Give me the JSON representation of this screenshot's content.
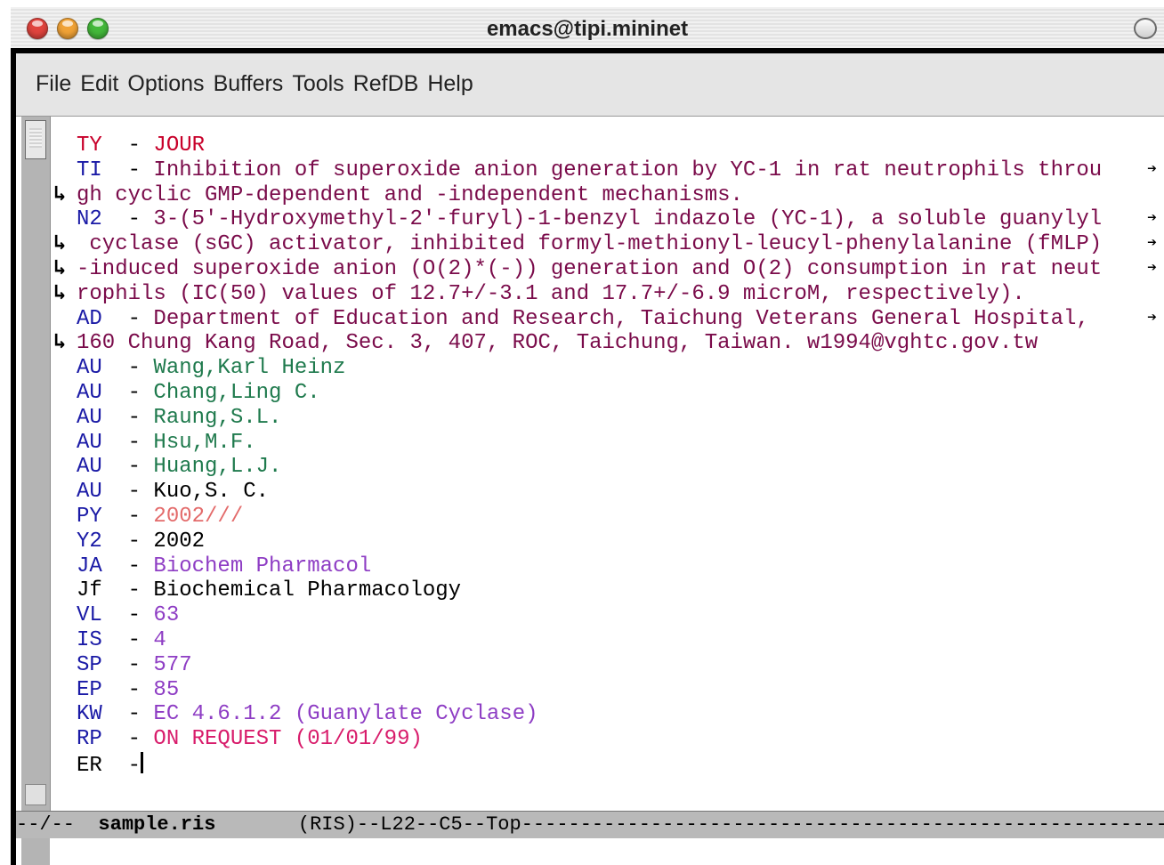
{
  "window": {
    "title": "emacs@tipi.mininet"
  },
  "menu": [
    "File",
    "Edit",
    "Options",
    "Buffers",
    "Tools",
    "RefDB",
    "Help"
  ],
  "lines": [
    {
      "wrap": "",
      "tag": "TY",
      "sep": "  - ",
      "value": "JOUR",
      "tag_color": "red",
      "value_color": "red",
      "end": ""
    },
    {
      "wrap": "",
      "tag": "TI",
      "sep": "  - ",
      "value": "Inhibition of superoxide anion generation by YC-1 in rat neutrophils throu",
      "tag_color": "blue",
      "value_color": "maroon",
      "end": "➔"
    },
    {
      "wrap": "↳",
      "tag": "",
      "sep": "",
      "value": "gh cyclic GMP-dependent and -independent mechanisms.",
      "tag_color": "blue",
      "value_color": "maroon",
      "end": ""
    },
    {
      "wrap": "",
      "tag": "N2",
      "sep": "  - ",
      "value": "3-(5'-Hydroxymethyl-2'-furyl)-1-benzyl indazole (YC-1), a soluble guanylyl",
      "tag_color": "blue",
      "value_color": "maroon",
      "end": "➔"
    },
    {
      "wrap": "↳",
      "tag": "",
      "sep": "",
      "value": " cyclase (sGC) activator, inhibited formyl-methionyl-leucyl-phenylalanine (fMLP)",
      "tag_color": "blue",
      "value_color": "maroon",
      "end": "➔"
    },
    {
      "wrap": "↳",
      "tag": "",
      "sep": "",
      "value": "-induced superoxide anion (O(2)*(-)) generation and O(2) consumption in rat neut",
      "tag_color": "blue",
      "value_color": "maroon",
      "end": "➔"
    },
    {
      "wrap": "↳",
      "tag": "",
      "sep": "",
      "value": "rophils (IC(50) values of 12.7+/-3.1 and 17.7+/-6.9 microM, respectively).",
      "tag_color": "blue",
      "value_color": "maroon",
      "end": ""
    },
    {
      "wrap": "",
      "tag": "AD",
      "sep": "  - ",
      "value": "Department of Education and Research, Taichung Veterans General Hospital, ",
      "tag_color": "blue",
      "value_color": "maroon",
      "end": "➔"
    },
    {
      "wrap": "↳",
      "tag": "",
      "sep": "",
      "value": "160 Chung Kang Road, Sec. 3, 407, ROC, Taichung, Taiwan. w1994@vghtc.gov.tw",
      "tag_color": "blue",
      "value_color": "maroon",
      "end": ""
    },
    {
      "wrap": "",
      "tag": "AU",
      "sep": "  - ",
      "value": "Wang,Karl Heinz",
      "tag_color": "blue",
      "value_color": "green",
      "end": ""
    },
    {
      "wrap": "",
      "tag": "AU",
      "sep": "  - ",
      "value": "Chang,Ling C.",
      "tag_color": "blue",
      "value_color": "green",
      "end": ""
    },
    {
      "wrap": "",
      "tag": "AU",
      "sep": "  - ",
      "value": "Raung,S.L.",
      "tag_color": "blue",
      "value_color": "green",
      "end": ""
    },
    {
      "wrap": "",
      "tag": "AU",
      "sep": "  - ",
      "value": "Hsu,M.F.",
      "tag_color": "blue",
      "value_color": "green",
      "end": ""
    },
    {
      "wrap": "",
      "tag": "AU",
      "sep": "  - ",
      "value": "Huang,L.J.",
      "tag_color": "blue",
      "value_color": "green",
      "end": ""
    },
    {
      "wrap": "",
      "tag": "AU",
      "sep": "  - ",
      "value": "Kuo,S. C.",
      "tag_color": "blue",
      "value_color": "black",
      "end": ""
    },
    {
      "wrap": "",
      "tag": "PY",
      "sep": "  - ",
      "value": "2002///",
      "tag_color": "blue",
      "value_color": "salmon",
      "end": ""
    },
    {
      "wrap": "",
      "tag": "Y2",
      "sep": "  - ",
      "value": "2002",
      "tag_color": "blue",
      "value_color": "black",
      "end": ""
    },
    {
      "wrap": "",
      "tag": "JA",
      "sep": "  - ",
      "value": "Biochem Pharmacol",
      "tag_color": "blue",
      "value_color": "purple",
      "end": ""
    },
    {
      "wrap": "",
      "tag": "Jf",
      "sep": "  - ",
      "value": "Biochemical Pharmacology",
      "tag_color": "black",
      "value_color": "black",
      "end": ""
    },
    {
      "wrap": "",
      "tag": "VL",
      "sep": "  - ",
      "value": "63",
      "tag_color": "blue",
      "value_color": "purple",
      "end": ""
    },
    {
      "wrap": "",
      "tag": "IS",
      "sep": "  - ",
      "value": "4",
      "tag_color": "blue",
      "value_color": "purple",
      "end": ""
    },
    {
      "wrap": "",
      "tag": "SP",
      "sep": "  - ",
      "value": "577",
      "tag_color": "blue",
      "value_color": "purple",
      "end": ""
    },
    {
      "wrap": "",
      "tag": "EP",
      "sep": "  - ",
      "value": "85",
      "tag_color": "blue",
      "value_color": "purple",
      "end": ""
    },
    {
      "wrap": "",
      "tag": "KW",
      "sep": "  - ",
      "value": "EC 4.6.1.2 (Guanylate Cyclase)",
      "tag_color": "blue",
      "value_color": "purple",
      "end": ""
    },
    {
      "wrap": "",
      "tag": "RP",
      "sep": "  - ",
      "value": "ON REQUEST (01/01/99)",
      "tag_color": "blue",
      "value_color": "magenta",
      "end": ""
    },
    {
      "wrap": "",
      "tag": "ER",
      "sep": "  -",
      "value": "",
      "tag_color": "black",
      "value_color": "black",
      "end": "",
      "cursor": true
    }
  ],
  "modeline": {
    "prefix": "--/--  ",
    "buffer": "sample.ris",
    "rest": "       (RIS)--L22--C5--Top------------------------------------------------------------"
  },
  "colors": {
    "red": "#c8002a",
    "blue": "#1a1aa6",
    "maroon": "#7a0b4a",
    "green": "#1f7a4d",
    "purple": "#8e3dc4",
    "black": "#000000",
    "salmon": "#e36b6b",
    "magenta": "#d81c6b"
  }
}
